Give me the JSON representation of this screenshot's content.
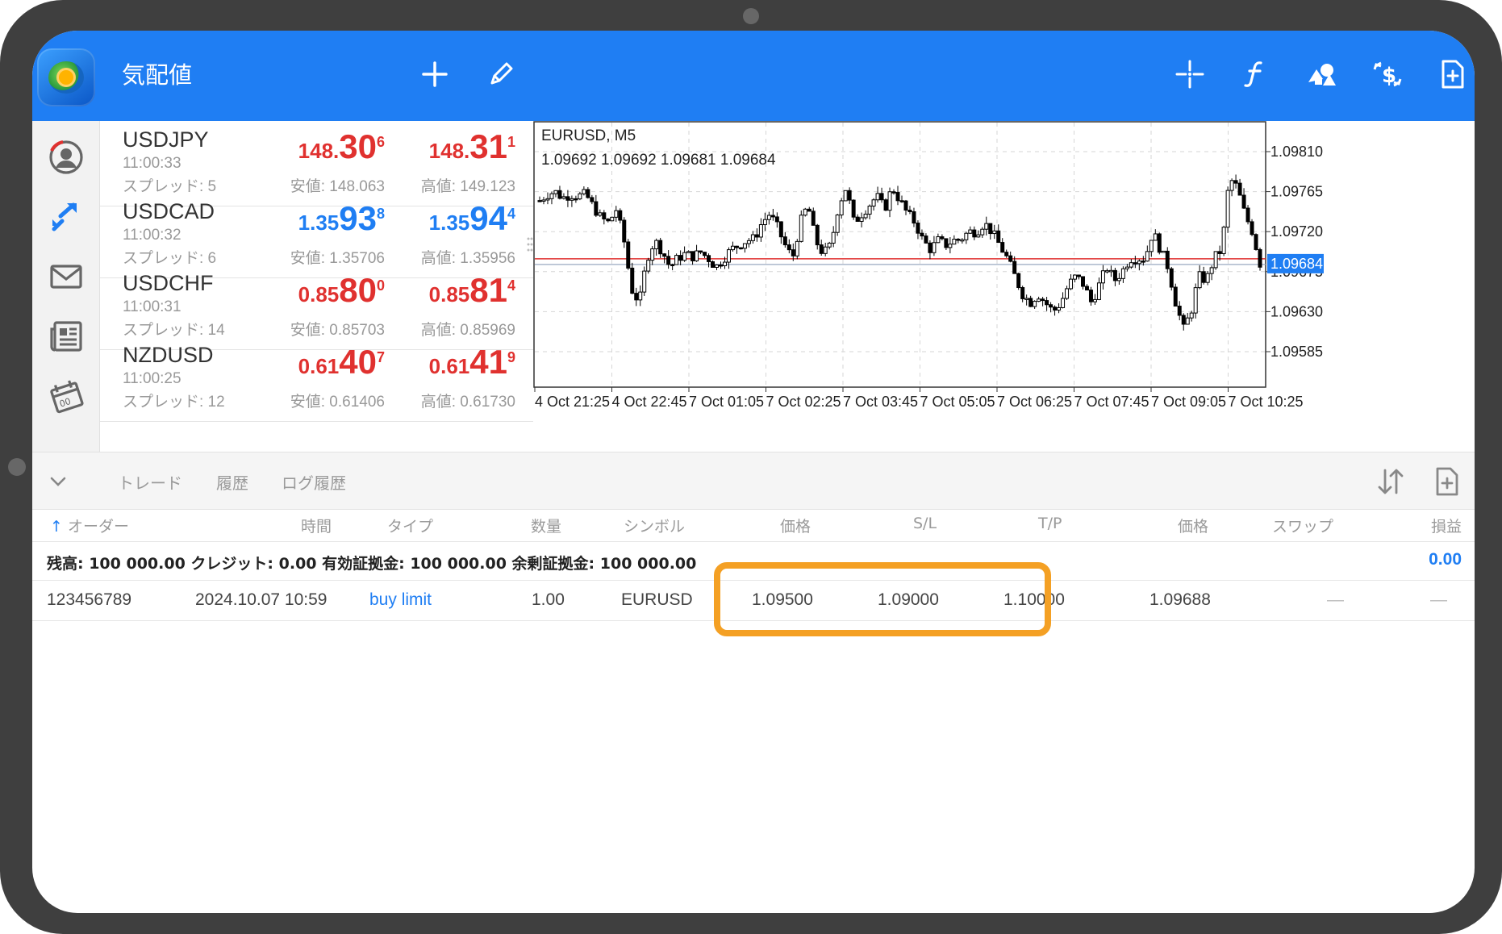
{
  "header": {
    "title": "気配値",
    "icons": [
      "plus-icon",
      "pencil-icon",
      "crosshair-icon",
      "function-icon",
      "objects-icon",
      "dollar-icon",
      "new-order-icon"
    ]
  },
  "rail": {
    "icons": [
      "account-icon",
      "trade-icon",
      "mail-icon",
      "news-icon",
      "calendar-icon"
    ]
  },
  "quotes": [
    {
      "symbol": "USDJPY",
      "time": "11:00:33",
      "spread": "スプレッド: 5",
      "bid": {
        "pre": "148.",
        "big": "30",
        "sup": "6"
      },
      "ask": {
        "pre": "148.",
        "big": "31",
        "sup": "1"
      },
      "color": "red",
      "low": "安値: 148.063",
      "high": "高値: 149.123"
    },
    {
      "symbol": "USDCAD",
      "time": "11:00:32",
      "spread": "スプレッド: 6",
      "bid": {
        "pre": "1.35",
        "big": "93",
        "sup": "8"
      },
      "ask": {
        "pre": "1.35",
        "big": "94",
        "sup": "4"
      },
      "color": "blue",
      "low": "安値: 1.35706",
      "high": "高値: 1.35956"
    },
    {
      "symbol": "USDCHF",
      "time": "11:00:31",
      "spread": "スプレッド: 14",
      "bid": {
        "pre": "0.85",
        "big": "80",
        "sup": "0"
      },
      "ask": {
        "pre": "0.85",
        "big": "81",
        "sup": "4"
      },
      "color": "red",
      "low": "安値: 0.85703",
      "high": "高値: 0.85969"
    },
    {
      "symbol": "NZDUSD",
      "time": "11:00:25",
      "spread": "スプレッド: 12",
      "bid": {
        "pre": "0.61",
        "big": "40",
        "sup": "7"
      },
      "ask": {
        "pre": "0.61",
        "big": "41",
        "sup": "9"
      },
      "color": "red",
      "low": "安値: 0.61406",
      "high": "高値: 0.61730"
    }
  ],
  "chart": {
    "title": "EURUSD, M5",
    "ohlc": "1.09692 1.09692 1.09681 1.09684",
    "y_labels": [
      "1.09810",
      "1.09765",
      "1.09720",
      "1.09675",
      "1.09630",
      "1.09585"
    ],
    "y_values": [
      1.0981,
      1.09765,
      1.0972,
      1.09675,
      1.0963,
      1.09585
    ],
    "current_price": "1.09684",
    "current_value": 1.09684,
    "x_labels": [
      "4 Oct 21:25",
      "4 Oct 22:45",
      "7 Oct 01:05",
      "7 Oct 02:25",
      "7 Oct 03:45",
      "7 Oct 05:05",
      "7 Oct 06:25",
      "7 Oct 07:45",
      "7 Oct 09:05",
      "7 Oct 10:25"
    ],
    "colors": {
      "bid_line": "#e0312f",
      "ask_line": "#9aa8c0",
      "price_tag": "#1f7ef3",
      "grid": "#d6d6d6"
    }
  },
  "chart_data": {
    "type": "candlestick",
    "title": "EURUSD, M5",
    "ylim": [
      1.0955,
      1.0985
    ],
    "y_ticks": [
      1.0981,
      1.09765,
      1.0972,
      1.09675,
      1.0963,
      1.09585
    ],
    "x_ticks": [
      "4 Oct 21:25",
      "4 Oct 22:45",
      "7 Oct 01:05",
      "7 Oct 02:25",
      "7 Oct 03:45",
      "7 Oct 05:05",
      "7 Oct 06:25",
      "7 Oct 07:45",
      "7 Oct 09:05",
      "7 Oct 10:25"
    ],
    "close_path": [
      1.09755,
      1.09762,
      1.09765,
      1.09758,
      1.09762,
      1.0976,
      1.09762,
      1.09748,
      1.09735,
      1.0973,
      1.09745,
      1.0971,
      1.09655,
      1.0964,
      1.0969,
      1.0971,
      1.09698,
      1.0968,
      1.0969,
      1.09695,
      1.09692,
      1.09697,
      1.0969,
      1.0968,
      1.0969,
      1.097,
      1.09705,
      1.0971,
      1.09712,
      1.0973,
      1.0974,
      1.09725,
      1.09705,
      1.0969,
      1.0973,
      1.0975,
      1.0971,
      1.09695,
      1.09705,
      1.0975,
      1.0977,
      1.0973,
      1.0974,
      1.0975,
      1.0976,
      1.09745,
      1.0977,
      1.09755,
      1.0974,
      1.0973,
      1.0971,
      1.097,
      1.0971,
      1.09705,
      1.0971,
      1.09712,
      1.0972,
      1.0972,
      1.0973,
      1.0972,
      1.09705,
      1.0969,
      1.0967,
      1.0965,
      1.0964,
      1.0965,
      1.0964,
      1.0963,
      1.0964,
      1.0966,
      1.0967,
      1.0966,
      1.0964,
      1.0966,
      1.0968,
      1.09665,
      1.09675,
      1.0969,
      1.0969,
      1.0969,
      1.0972,
      1.097,
      1.0968,
      1.0964,
      1.0961,
      1.0963,
      1.0967,
      1.09665,
      1.0969,
      1.097,
      1.0978,
      1.0977,
      1.0974,
      1.0972,
      1.09684
    ]
  },
  "panel": {
    "tabs": [
      "トレード",
      "履歴",
      "ログ履歴"
    ],
    "headers": {
      "order": "オーダー",
      "time": "時間",
      "type": "タイプ",
      "volume": "数量",
      "symbol": "シンボル",
      "price": "価格",
      "sl": "S/L",
      "tp": "T/P",
      "cur_price": "価格",
      "swap": "スワップ",
      "profit": "損益"
    },
    "summary": "残高: 100 000.00  クレジット: 0.00  有効証拠金: 100 000.00  余剰証拠金: 100 000.00",
    "total_profit": "0.00",
    "order": {
      "id": "123456789",
      "time": "2024.10.07 10:59",
      "type": "buy limit",
      "volume": "1.00",
      "symbol": "EURUSD",
      "price": "1.09500",
      "sl": "1.09000",
      "tp": "1.10000",
      "current": "1.09688",
      "swap": "—",
      "profit": "—"
    },
    "highlight_color": "#f4a024"
  }
}
